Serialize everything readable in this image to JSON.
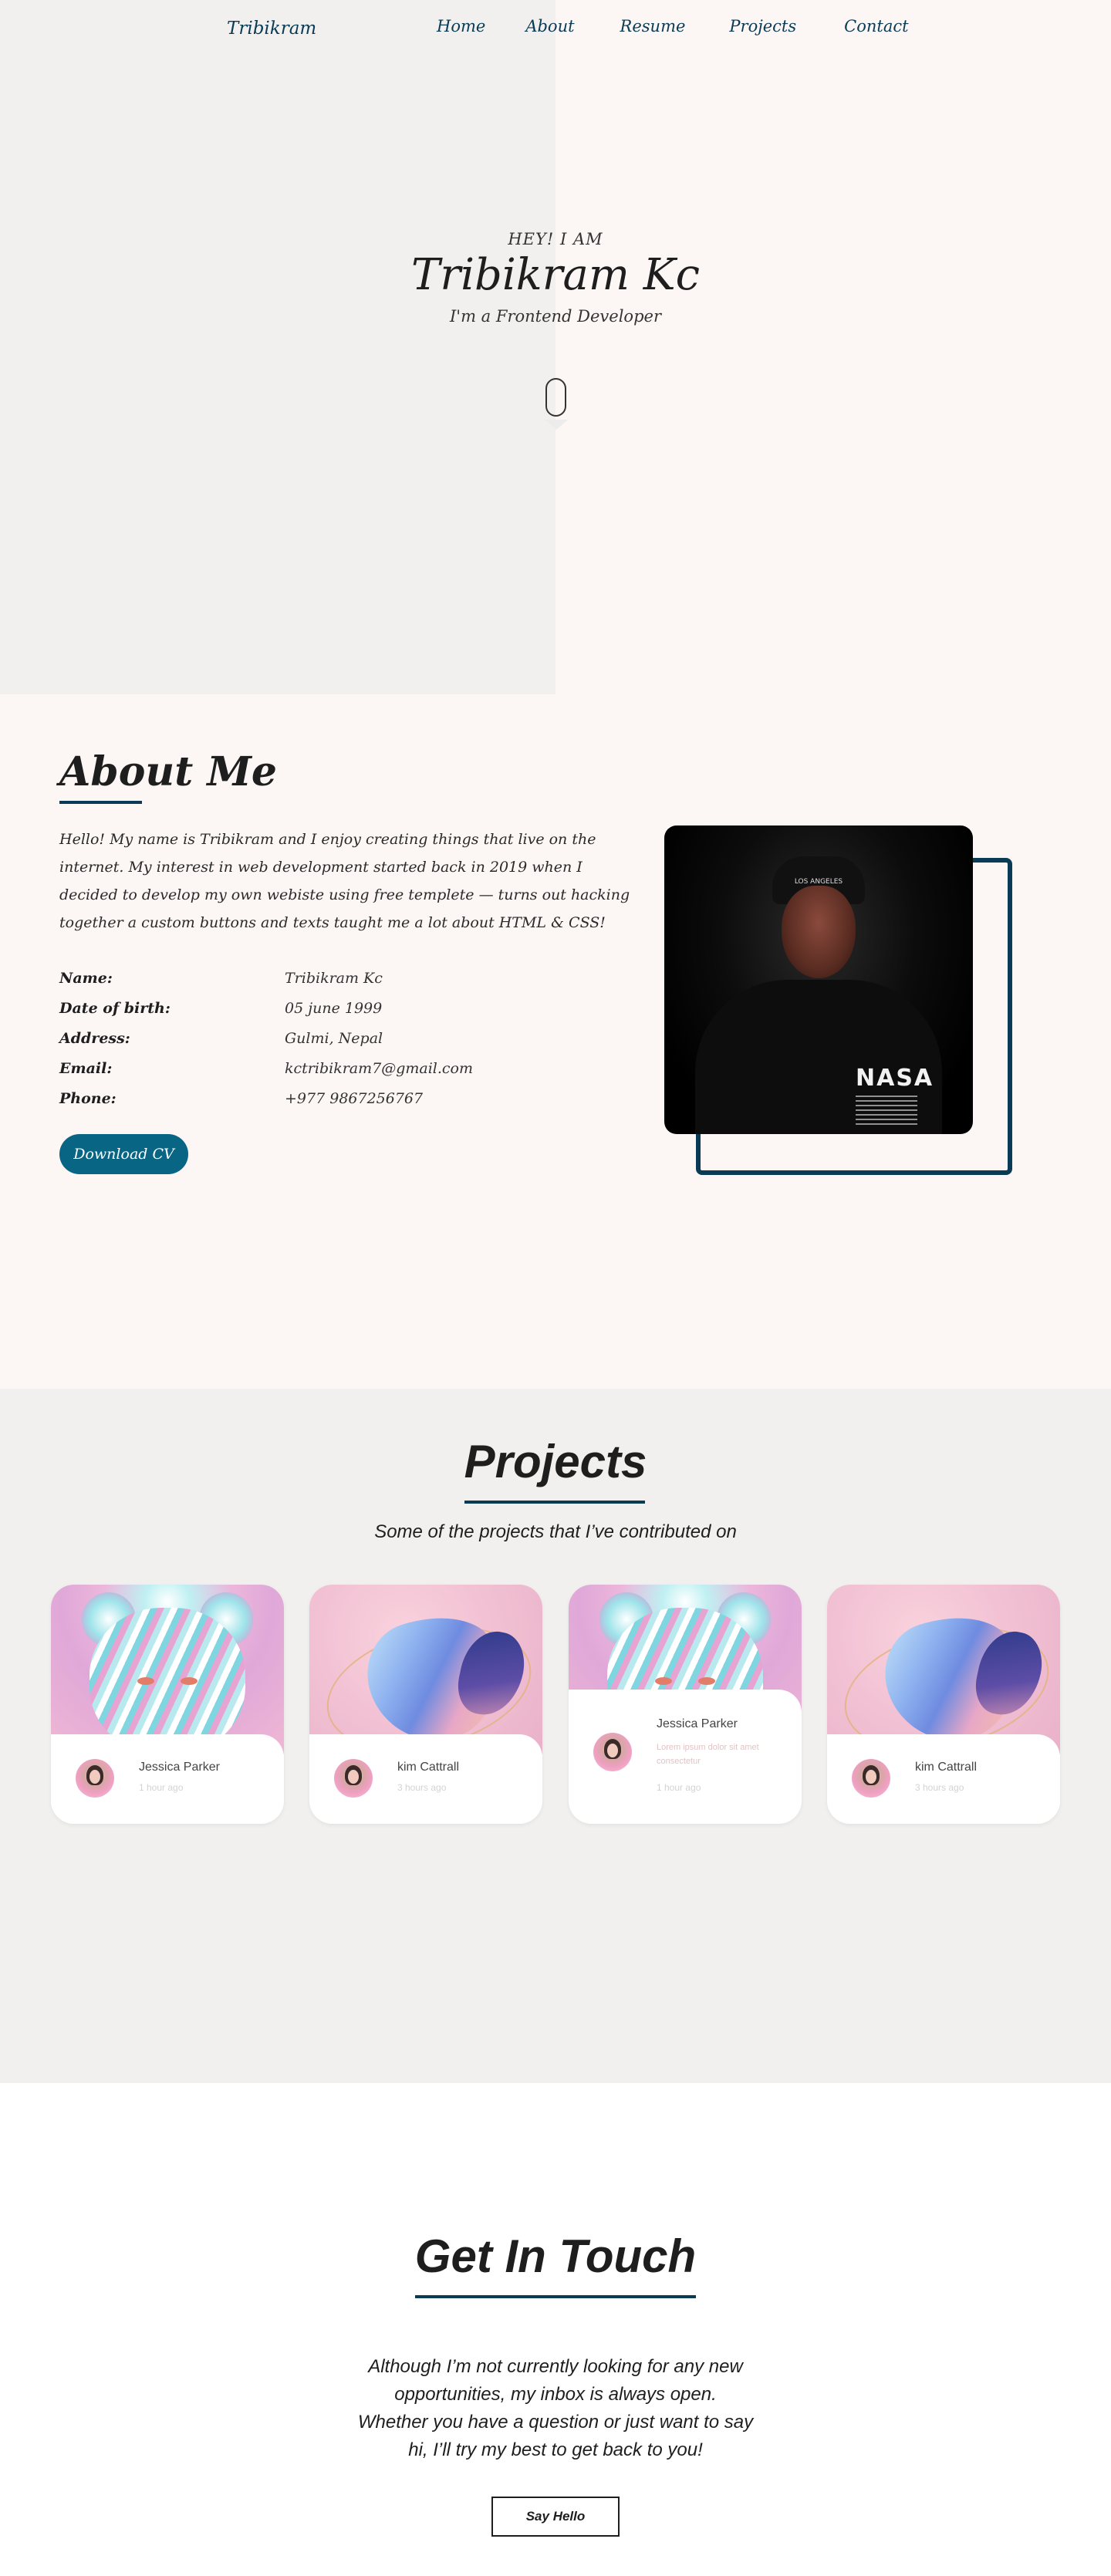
{
  "nav": {
    "logo": "Tribikram",
    "links": [
      "Home",
      "About",
      "Resume",
      "Projects",
      "Contact"
    ]
  },
  "hero": {
    "greeting": "HEY! I AM",
    "name": "Tribikram Kc",
    "role": "I'm a Frontend Developer"
  },
  "about": {
    "title": "About Me",
    "bio": "Hello! My name is Tribikram and I enjoy creating things that live on the internet. My interest in web development started back in 2019 when I decided to develop my own webiste using free templete — turns out hacking together a custom buttons and texts taught me a lot about HTML & CSS!",
    "info": [
      {
        "label": "Name:",
        "value": "Tribikram Kc"
      },
      {
        "label": "Date of birth:",
        "value": "05 june 1999"
      },
      {
        "label": "Address:",
        "value": "Gulmi, Nepal"
      },
      {
        "label": "Email:",
        "value": "kctribikram7@gmail.com"
      },
      {
        "label": "Phone:",
        "value": "+977 9867256767"
      }
    ],
    "cv_button": "Download CV",
    "photo_cap_text": "LOS ANGELES",
    "photo_shirt_text": "NASA"
  },
  "projects": {
    "title": "Projects",
    "subtitle": "Some of the projects that I’ve contributed on",
    "cards": [
      {
        "name": "Jessica Parker",
        "time": "1 hour ago",
        "art": "bear-art"
      },
      {
        "name": "kim Cattrall",
        "time": "3 hours ago",
        "art": "blob-art"
      },
      {
        "name": "Jessica Parker",
        "desc": "Lorem ipsum dolor sit amet consectetur",
        "time": "1 hour ago",
        "art": "bear-art"
      },
      {
        "name": "kim Cattrall",
        "time": "3 hours ago",
        "art": "blob-art"
      }
    ]
  },
  "contact": {
    "title": "Get In Touch",
    "lines": [
      "Although I’m not currently looking for any new",
      "opportunities, my inbox is always open.",
      "Whether you have a question or just want to say",
      "hi, I’ll try my best to get back to you!"
    ],
    "button": "Say Hello"
  },
  "colors": {
    "accent": "#0a3b55",
    "button": "#086584",
    "hero_left_bg": "#f1f0ee",
    "hero_right_bg": "#fcf6f5"
  }
}
